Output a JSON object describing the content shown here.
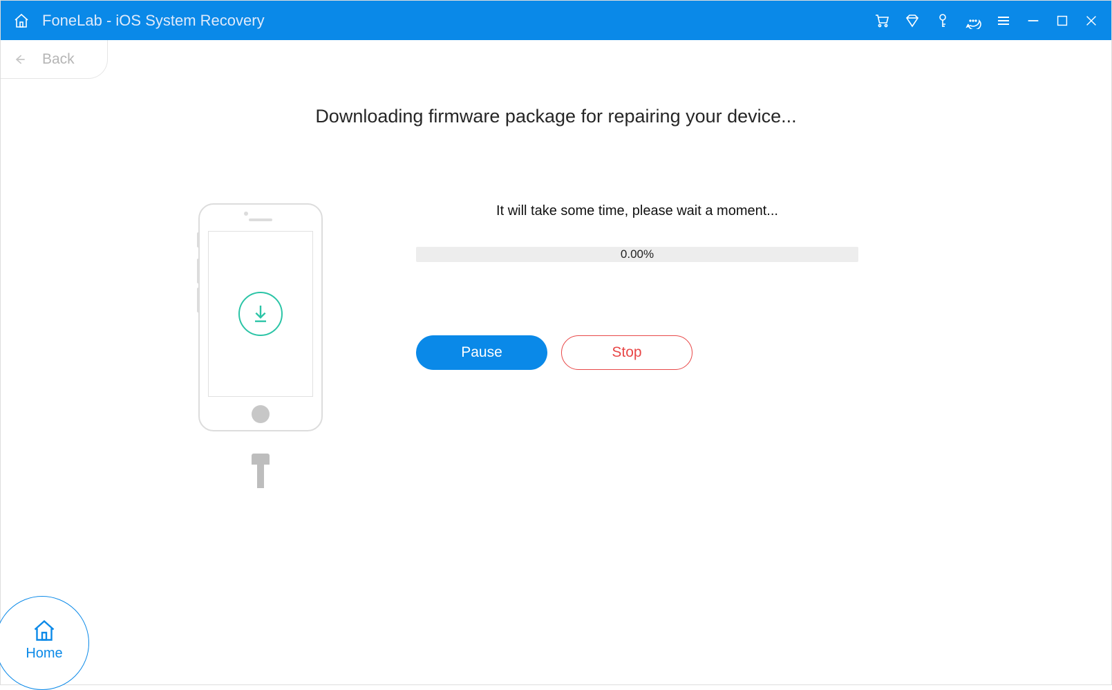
{
  "app": {
    "title": "FoneLab - iOS System Recovery"
  },
  "nav": {
    "back_label": "Back",
    "home_label": "Home"
  },
  "page": {
    "heading": "Downloading firmware package for repairing your device...",
    "wait_text": "It will take some time, please wait a moment...",
    "progress_text": "0.00%"
  },
  "buttons": {
    "pause": "Pause",
    "stop": "Stop"
  }
}
